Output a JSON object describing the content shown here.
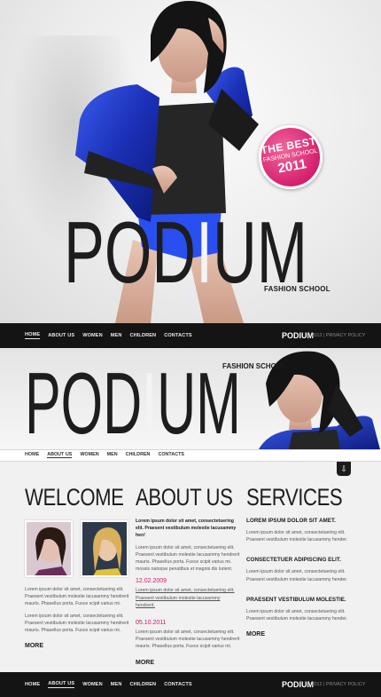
{
  "hero": {
    "logo_left": "POD",
    "logo_i": "I",
    "logo_right": "UM",
    "tagline": "FASHION SCHOOL",
    "badge": {
      "line1": "THE BEST",
      "line2": "FASHION SCHOOL",
      "line3": "2011"
    }
  },
  "nav": {
    "items": [
      "HOME",
      "ABOUT US",
      "WOMEN",
      "MEN",
      "CHILDREN",
      "CONTACTS"
    ],
    "brand": "PODIUM",
    "copyright": "© 2012 | PRIVACY POLICY"
  },
  "section2": {
    "tagline": "FASHION SCHOOL",
    "subnav": [
      "HOME",
      "ABOUT US",
      "WOMEN",
      "MEN",
      "CHILDREN",
      "CONTACTS"
    ]
  },
  "welcome": {
    "title": "WELCOME",
    "p1": "Lorem ipsum dolor sit amet, consectetuering elit. Praesent vestibulum molestie lacusammy hendrerit mauris. Phasellus porta. Fusce scipit varius mi.",
    "p2": "Lorem ipsum dolor sit amet, consectetuering elit. Praesent vestibulum molestie lacusammy hendrerit mauris. Phasellus porta. Fusce scipit varius mi.",
    "more": "MORE"
  },
  "about": {
    "title": "ABOUT US",
    "lead": "Lorem ipsum dolor sit amet, consectetuering elit. Praesent vestibulum molestie lacusammy hen!",
    "p1": "Lorem ipsum dolor sit amet, consectetuering elit. Praesent vestibulum molestie lacusammy hendrerit mauris. Phasellus porta. Fusce scipit varius mi. mossis natoque penatibus et magnis dis lurient.",
    "date1": "12.02.2009",
    "p2": "Lorem ipsum dolor sit amet, consectetuering elit. Praesent vestibulum molestie lacusammy hendrerit.",
    "date2": "05.10.2011",
    "p3": "Lorem ipsum dolor sit amet, consectetuering elit. Praesent vestibulum molestie lacusammy hendrerit mauris. Phasellus porta. Fusce scipit varius mi.",
    "more": "MORE"
  },
  "services": {
    "title": "SERVICES",
    "items": [
      {
        "title": "LOREM IPSUM DOLOR SIT AMET.",
        "text": "Lorem ipsum dolor sit amet, consectetuering elit. Praesent vestibulum molestie lacusammy hender."
      },
      {
        "title": "CONSECTETUER ADIPISCING ELIT.",
        "text": "Lorem ipsum dolor sit amet, consectetuering elit. Praesent vestibulum molestie lacusammy hender."
      },
      {
        "title": "PRAESENT VESTIBULUM MOLESTIE.",
        "text": "Lorem ipsum dolor sit amet, consectetuering elit. Praesent vestibulum molestie lacusammy hender."
      }
    ],
    "more": "MORE"
  },
  "colors": {
    "accent": "#d0186a",
    "navbar": "#141414",
    "jacket": "#1f3fd0"
  }
}
